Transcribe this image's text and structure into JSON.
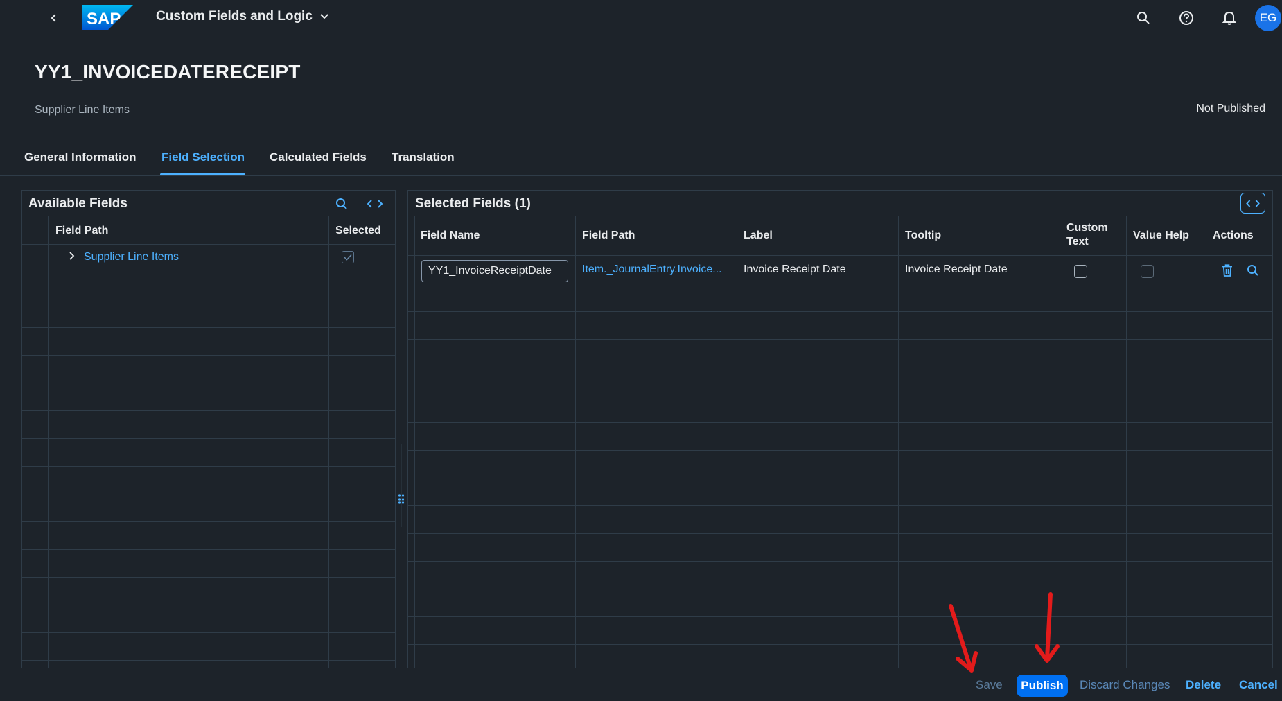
{
  "shell": {
    "title": "Custom Fields and Logic",
    "logo_text": "SAP",
    "avatar_initials": "EG",
    "icons": [
      "back-icon",
      "chevron-down-icon",
      "search-icon",
      "help-icon",
      "notification-bell-icon"
    ]
  },
  "header": {
    "title": "YY1_INVOICEDATERECEIPT",
    "subtitle": "Supplier Line Items",
    "status": "Not Published"
  },
  "tabs": [
    {
      "label": "General Information",
      "active": false
    },
    {
      "label": "Field Selection",
      "active": true
    },
    {
      "label": "Calculated Fields",
      "active": false
    },
    {
      "label": "Translation",
      "active": false
    }
  ],
  "available_fields": {
    "title": "Available Fields",
    "columns": [
      "Field Path",
      "Selected"
    ],
    "rows": [
      {
        "field_path": "Supplier Line Items",
        "selected": true
      }
    ]
  },
  "selected_fields": {
    "title": "Selected Fields (1)",
    "columns": [
      "Field Name",
      "Field Path",
      "Label",
      "Tooltip",
      "Custom Text",
      "Value Help",
      "Actions"
    ],
    "rows": [
      {
        "field_name": "YY1_InvoiceReceiptDate",
        "field_path": "Item._JournalEntry.Invoice...",
        "label": "Invoice Receipt Date",
        "tooltip": "Invoice Receipt Date",
        "custom_text": false,
        "value_help": false
      }
    ]
  },
  "footer": {
    "save": "Save",
    "publish": "Publish",
    "discard": "Discard Changes",
    "delete": "Delete",
    "cancel": "Cancel"
  },
  "colors": {
    "background": "#1d232a",
    "accent": "#4db1ff",
    "emphasized_button": "#0070f2",
    "annotation_arrow": "#e31b1b"
  }
}
